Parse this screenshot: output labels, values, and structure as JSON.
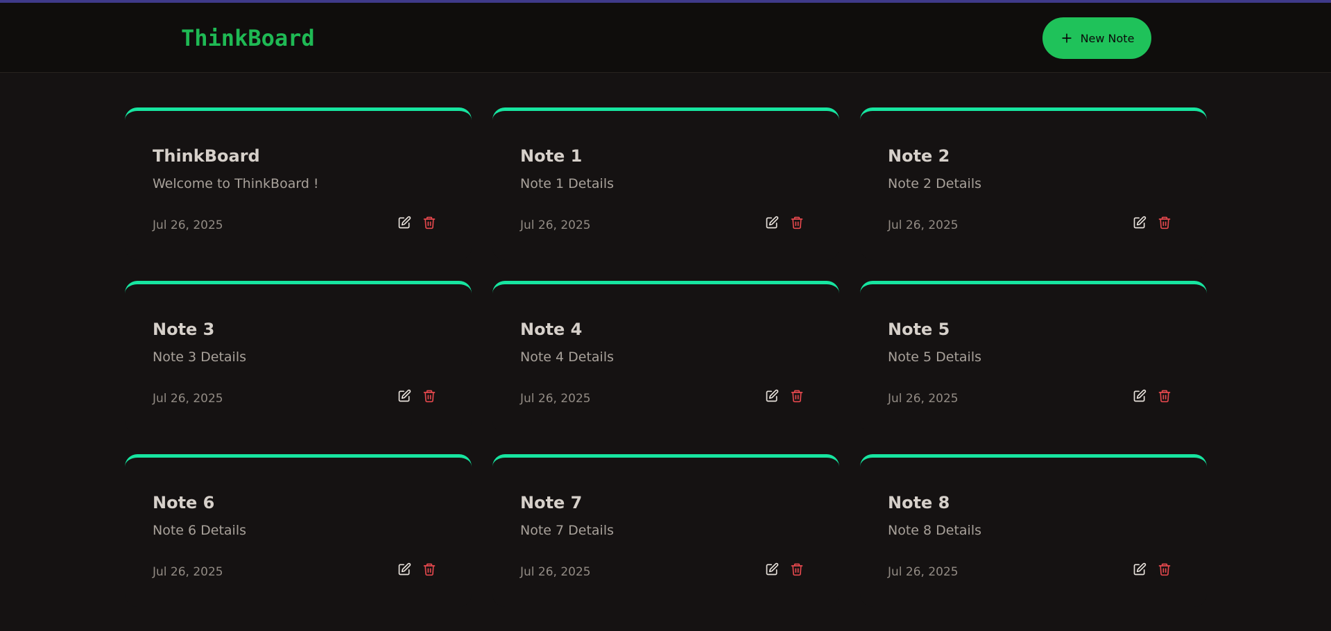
{
  "header": {
    "brand": "ThinkBoard",
    "new_note_label": "New Note"
  },
  "colors": {
    "accent": "#1fc25a",
    "card_border": "#17e5a0",
    "delete": "#e5484d",
    "background": "#151212"
  },
  "notes": [
    {
      "title": "ThinkBoard",
      "content": "Welcome to ThinkBoard !",
      "date": "Jul 26, 2025"
    },
    {
      "title": "Note 1",
      "content": "Note 1 Details",
      "date": "Jul 26, 2025"
    },
    {
      "title": "Note 2",
      "content": "Note 2 Details",
      "date": "Jul 26, 2025"
    },
    {
      "title": "Note 3",
      "content": "Note 3 Details",
      "date": "Jul 26, 2025"
    },
    {
      "title": "Note 4",
      "content": "Note 4 Details",
      "date": "Jul 26, 2025"
    },
    {
      "title": "Note 5",
      "content": "Note 5 Details",
      "date": "Jul 26, 2025"
    },
    {
      "title": "Note 6",
      "content": "Note 6 Details",
      "date": "Jul 26, 2025"
    },
    {
      "title": "Note 7",
      "content": "Note 7 Details",
      "date": "Jul 26, 2025"
    },
    {
      "title": "Note 8",
      "content": "Note 8 Details",
      "date": "Jul 26, 2025"
    }
  ],
  "icons": {
    "new_note": "plus-icon",
    "edit": "edit-icon",
    "delete": "trash-icon"
  }
}
